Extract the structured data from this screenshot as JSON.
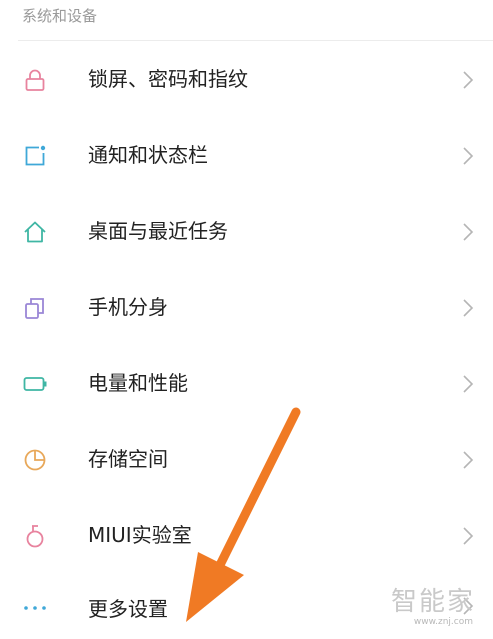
{
  "section": {
    "title": "系统和设备"
  },
  "items": [
    {
      "label": "锁屏、密码和指纹",
      "icon": "lock-icon",
      "color": "#e8839e"
    },
    {
      "label": "通知和状态栏",
      "icon": "notification-icon",
      "color": "#3fa8d8"
    },
    {
      "label": "桌面与最近任务",
      "icon": "home-icon",
      "color": "#3fb6a4"
    },
    {
      "label": "手机分身",
      "icon": "dual-apps-icon",
      "color": "#9a86d6"
    },
    {
      "label": "电量和性能",
      "icon": "battery-icon",
      "color": "#3fb6a4"
    },
    {
      "label": "存储空间",
      "icon": "storage-icon",
      "color": "#e8a85a"
    },
    {
      "label": "MIUI实验室",
      "icon": "lab-flask-icon",
      "color": "#e8839e"
    },
    {
      "label": "更多设置",
      "icon": "more-dots-icon",
      "color": "#3fa8d8"
    }
  ],
  "annotation": {
    "arrow_color": "#f07a24"
  },
  "watermark": {
    "brand": "智能家",
    "url": "www.znj.com"
  }
}
